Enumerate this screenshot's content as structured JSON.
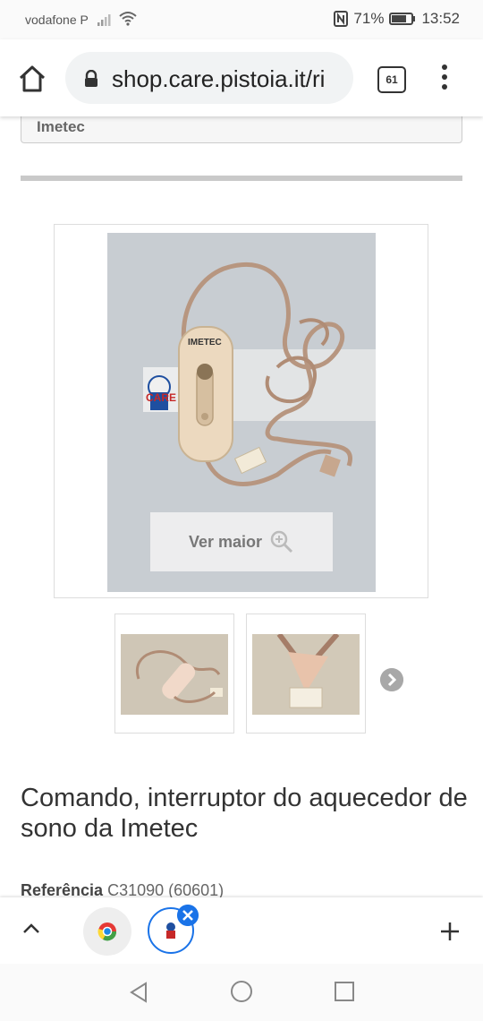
{
  "status_bar": {
    "carrier": "vodafone P",
    "battery": "71%",
    "time": "13:52"
  },
  "browser": {
    "url": "shop.care.pistoia.it/ri",
    "tab_count": "61"
  },
  "product": {
    "brand": "Imetec",
    "image_button_label": "Ver maior",
    "title": "Comando, interruptor do aquecedor de sono da Imetec",
    "reference_label": "Referência",
    "reference_value": "C31090 (60601)",
    "device_brand_print": "IMETEC",
    "logo_text": "CARE"
  },
  "icons": {
    "home": "home-icon",
    "lock": "lock-icon",
    "tabs": "tab-switcher-icon",
    "menu": "more-vert-icon",
    "zoom": "zoom-in-icon",
    "next": "chevron-right-icon",
    "up": "chevron-up-icon",
    "close": "close-icon",
    "add": "plus-icon"
  },
  "colors": {
    "accent": "#1a73e8",
    "divider": "#c9c9c9"
  }
}
